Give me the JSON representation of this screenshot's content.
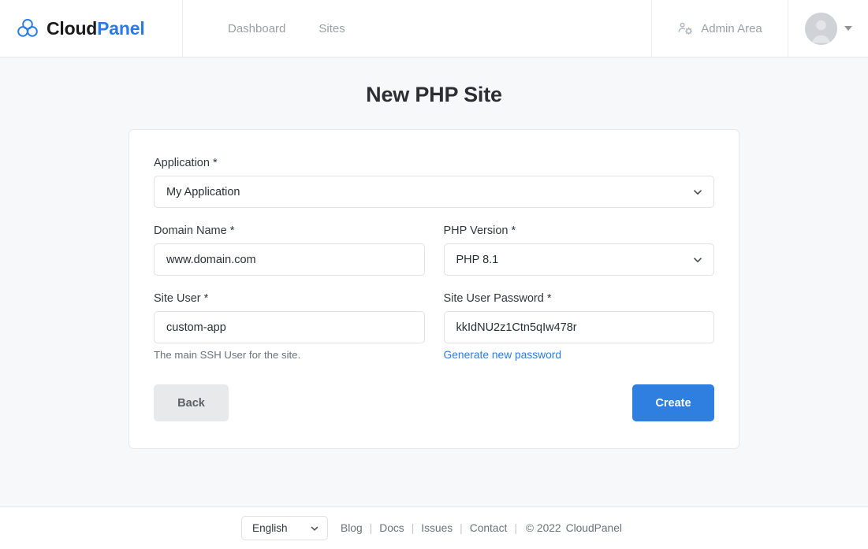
{
  "header": {
    "brand": {
      "text_dark": "Cloud",
      "text_accent": "Panel",
      "icon": "cloudpanel-logo-icon"
    },
    "nav": [
      {
        "label": "Dashboard",
        "name": "nav-dashboard"
      },
      {
        "label": "Sites",
        "name": "nav-sites"
      }
    ],
    "admin_area": {
      "label": "Admin Area",
      "icon": "users-cog-icon"
    },
    "account": {
      "avatar_icon": "user-avatar-icon",
      "caret_icon": "caret-down-icon"
    }
  },
  "main": {
    "title": "New PHP Site",
    "fields": {
      "application": {
        "label": "Application *",
        "value": "My Application",
        "options": [
          "My Application"
        ]
      },
      "domain_name": {
        "label": "Domain Name *",
        "value": "www.domain.com",
        "placeholder": ""
      },
      "php_version": {
        "label": "PHP Version *",
        "value": "PHP 8.1",
        "options": [
          "PHP 8.1"
        ]
      },
      "site_user": {
        "label": "Site User *",
        "value": "custom-app",
        "hint": "The main SSH User for the site."
      },
      "site_user_password": {
        "label": "Site User Password *",
        "value": "kkIdNU2z1Ctn5qIw478r",
        "generate_link": "Generate new password"
      }
    },
    "buttons": {
      "back": "Back",
      "create": "Create"
    }
  },
  "footer": {
    "language": {
      "value": "English",
      "options": [
        "English"
      ]
    },
    "links": [
      {
        "label": "Blog",
        "name": "footer-link-blog"
      },
      {
        "label": "Docs",
        "name": "footer-link-docs"
      },
      {
        "label": "Issues",
        "name": "footer-link-issues"
      },
      {
        "label": "Contact",
        "name": "footer-link-contact"
      }
    ],
    "separator": "|",
    "copyright_mark": "© 2022",
    "copyright_name": "CloudPanel"
  },
  "colors": {
    "accent": "#2c7be5",
    "primary_button": "#2f7fe0",
    "page_bg": "#f7f8fa",
    "muted_text": "#9aa0a8"
  }
}
